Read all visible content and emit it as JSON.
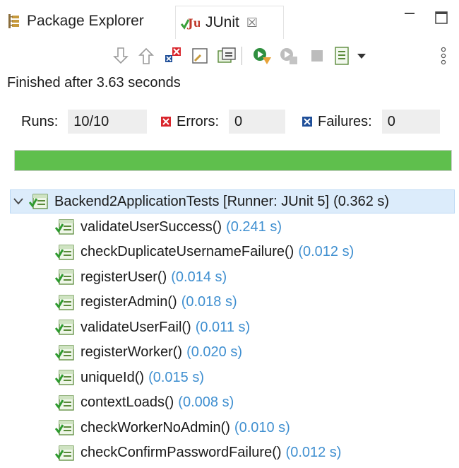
{
  "tabs": {
    "package_explorer": "Package Explorer",
    "junit": "JUnit",
    "junit_close": "☒"
  },
  "status": {
    "finished": "Finished after 3.63 seconds"
  },
  "counters": {
    "runs_label": "Runs:",
    "runs_value": "10/10",
    "errors_label": "Errors:",
    "errors_value": "0",
    "failures_label": "Failures:",
    "failures_value": "0"
  },
  "progress": {
    "fraction": 1.0,
    "color": "#5fbf4d"
  },
  "tree": {
    "root": {
      "name": "Backend2ApplicationTests [Runner: JUnit 5]",
      "time": "(0.362 s)"
    },
    "tests": [
      {
        "name": "validateUserSuccess()",
        "time": "(0.241 s)"
      },
      {
        "name": "checkDuplicateUsernameFailure()",
        "time": "(0.012 s)"
      },
      {
        "name": "registerUser()",
        "time": "(0.014 s)"
      },
      {
        "name": "registerAdmin()",
        "time": "(0.018 s)"
      },
      {
        "name": "validateUserFail()",
        "time": "(0.011 s)"
      },
      {
        "name": "registerWorker()",
        "time": "(0.020 s)"
      },
      {
        "name": "uniqueId()",
        "time": "(0.015 s)"
      },
      {
        "name": "contextLoads()",
        "time": "(0.008 s)"
      },
      {
        "name": "checkWorkerNoAdmin()",
        "time": "(0.010 s)"
      },
      {
        "name": "checkConfirmPasswordFailure()",
        "time": "(0.012 s)"
      }
    ]
  },
  "colors": {
    "time_text": "#3f8fd0",
    "selection": "#dcecfb",
    "error_red": "#d9262d",
    "failure_blue": "#1f4f99"
  }
}
